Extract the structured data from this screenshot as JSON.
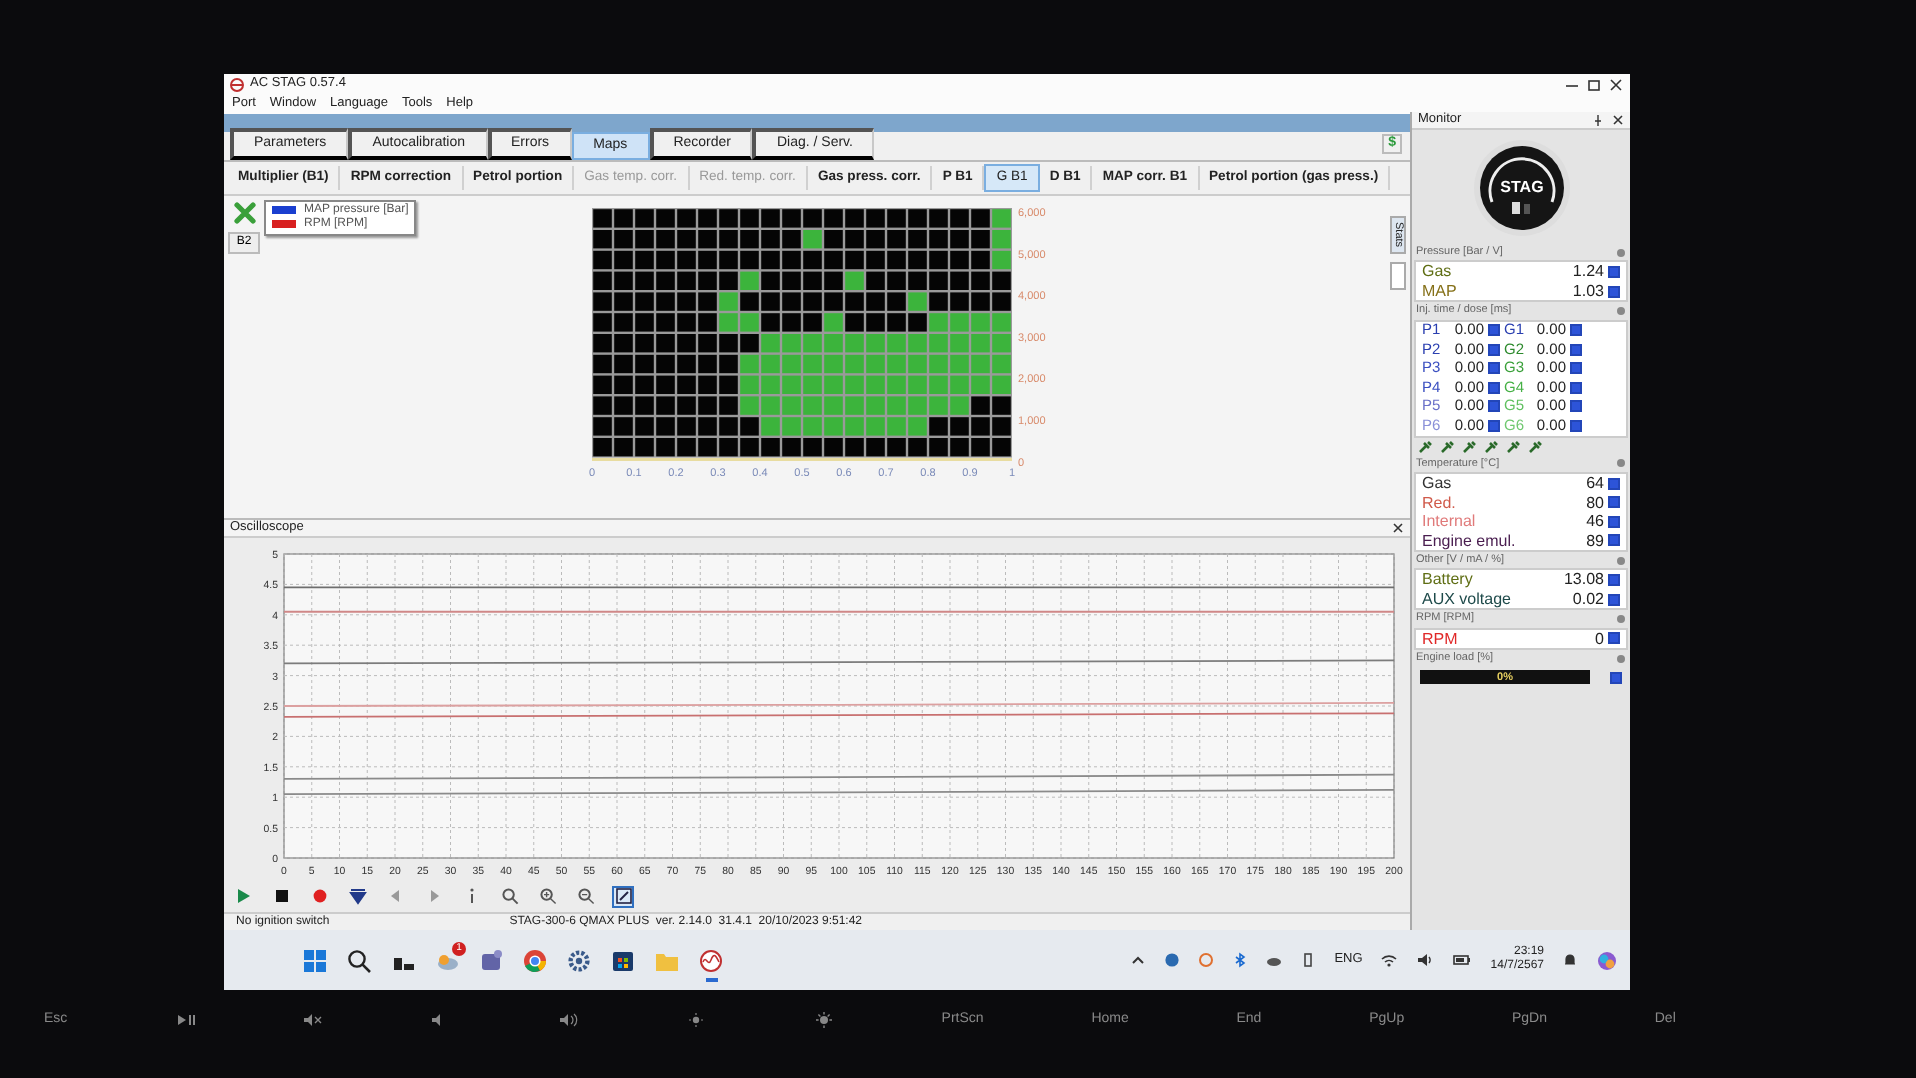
{
  "window": {
    "title": "AC STAG 0.57.4"
  },
  "menu": [
    "Port",
    "Window",
    "Language",
    "Tools",
    "Help"
  ],
  "tabs": [
    {
      "label": "Parameters",
      "selected": false
    },
    {
      "label": "Autocalibration",
      "selected": false
    },
    {
      "label": "Errors",
      "selected": false
    },
    {
      "label": "Maps",
      "selected": true
    },
    {
      "label": "Recorder",
      "selected": false
    },
    {
      "label": "Diag. / Serv.",
      "selected": false
    }
  ],
  "tabs_side_button": "$",
  "subtabs": [
    {
      "label": "Multiplier (B1)",
      "selected": false,
      "disabled": false
    },
    {
      "label": "RPM correction",
      "selected": false,
      "disabled": false
    },
    {
      "label": "Petrol portion",
      "selected": false,
      "disabled": false
    },
    {
      "label": "Gas temp. corr.",
      "selected": false,
      "disabled": true
    },
    {
      "label": "Red. temp. corr.",
      "selected": false,
      "disabled": true
    },
    {
      "label": "Gas press. corr.",
      "selected": false,
      "disabled": false
    },
    {
      "label": "P B1",
      "selected": false,
      "disabled": false
    },
    {
      "label": "G B1",
      "selected": true,
      "disabled": false
    },
    {
      "label": "D B1",
      "selected": false,
      "disabled": false
    },
    {
      "label": "MAP corr. B1",
      "selected": false,
      "disabled": false
    },
    {
      "label": "Petrol portion (gas press.)",
      "selected": false,
      "disabled": false
    }
  ],
  "map": {
    "bank_button": "B2",
    "legend": [
      {
        "label": "MAP pressure [Bar]",
        "color": "#1a3fd0"
      },
      {
        "label": "RPM [RPM]",
        "color": "#d82020"
      }
    ],
    "x_labels": [
      "0",
      "0.1",
      "0.2",
      "0.3",
      "0.4",
      "0.5",
      "0.6",
      "0.7",
      "0.8",
      "0.9",
      "1"
    ],
    "y_labels": [
      "6,000",
      "5,000",
      "4,000",
      "3,000",
      "2,000",
      "1,000",
      "0"
    ],
    "grid": [
      [
        false,
        false,
        false,
        false,
        false,
        false,
        false,
        false,
        false,
        false,
        false,
        false,
        false,
        false,
        false,
        false,
        false,
        false,
        false,
        true
      ],
      [
        false,
        false,
        false,
        false,
        false,
        false,
        false,
        false,
        false,
        false,
        true,
        false,
        false,
        false,
        false,
        false,
        false,
        false,
        false,
        true
      ],
      [
        false,
        false,
        false,
        false,
        false,
        false,
        false,
        false,
        false,
        false,
        false,
        false,
        false,
        false,
        false,
        false,
        false,
        false,
        false,
        true
      ],
      [
        false,
        false,
        false,
        false,
        false,
        false,
        false,
        true,
        false,
        false,
        false,
        false,
        true,
        false,
        false,
        false,
        false,
        false,
        false,
        false
      ],
      [
        false,
        false,
        false,
        false,
        false,
        false,
        true,
        false,
        false,
        false,
        false,
        false,
        false,
        false,
        false,
        true,
        false,
        false,
        false,
        false
      ],
      [
        false,
        false,
        false,
        false,
        false,
        false,
        true,
        true,
        false,
        false,
        false,
        true,
        false,
        false,
        false,
        false,
        true,
        true,
        true,
        true
      ],
      [
        false,
        false,
        false,
        false,
        false,
        false,
        false,
        false,
        true,
        true,
        true,
        true,
        true,
        true,
        true,
        true,
        true,
        true,
        true,
        true
      ],
      [
        false,
        false,
        false,
        false,
        false,
        false,
        false,
        true,
        true,
        true,
        true,
        true,
        true,
        true,
        true,
        true,
        true,
        true,
        true,
        true
      ],
      [
        false,
        false,
        false,
        false,
        false,
        false,
        false,
        true,
        true,
        true,
        true,
        true,
        true,
        true,
        true,
        true,
        true,
        true,
        true,
        true
      ],
      [
        false,
        false,
        false,
        false,
        false,
        false,
        false,
        true,
        true,
        true,
        true,
        true,
        true,
        true,
        true,
        true,
        true,
        true,
        false,
        false
      ],
      [
        false,
        false,
        false,
        false,
        false,
        false,
        false,
        false,
        true,
        true,
        true,
        true,
        true,
        true,
        true,
        true,
        false,
        false,
        false,
        false
      ],
      [
        false,
        false,
        false,
        false,
        false,
        false,
        false,
        false,
        false,
        false,
        false,
        false,
        false,
        false,
        false,
        false,
        false,
        false,
        false,
        false
      ]
    ],
    "side_tabs": [
      {
        "label": "Stats"
      }
    ]
  },
  "oscilloscope": {
    "title": "Oscilloscope",
    "chart_data": {
      "type": "line",
      "grid": true,
      "xlim": [
        0,
        200
      ],
      "ylim": [
        0,
        5
      ],
      "xticks": [
        0,
        5,
        10,
        15,
        20,
        25,
        30,
        35,
        40,
        45,
        50,
        55,
        60,
        65,
        70,
        75,
        80,
        85,
        90,
        95,
        100,
        105,
        110,
        115,
        120,
        125,
        130,
        135,
        140,
        145,
        150,
        155,
        160,
        165,
        170,
        175,
        180,
        185,
        190,
        195,
        200
      ],
      "yticks": [
        0,
        0.5,
        1,
        1.5,
        2,
        2.5,
        3,
        3.5,
        4,
        4.5,
        5
      ],
      "x": [
        0,
        100,
        200
      ],
      "series": [
        {
          "color": "#6e6e6e",
          "values": [
            4.45,
            4.45,
            4.45
          ]
        },
        {
          "color": "#d08888",
          "values": [
            4.05,
            4.05,
            4.05
          ]
        },
        {
          "color": "#7c7c7c",
          "values": [
            3.2,
            3.22,
            3.25
          ]
        },
        {
          "color": "#dca0a0",
          "values": [
            2.5,
            2.52,
            2.55
          ]
        },
        {
          "color": "#c87070",
          "values": [
            2.32,
            2.35,
            2.38
          ]
        },
        {
          "color": "#8a8a8a",
          "values": [
            1.3,
            1.33,
            1.37
          ]
        },
        {
          "color": "#8a8a8a",
          "values": [
            1.05,
            1.08,
            1.12
          ]
        }
      ]
    },
    "toolbar": [
      {
        "kind": "play",
        "selected": false
      },
      {
        "kind": "stop",
        "selected": false
      },
      {
        "kind": "record",
        "selected": false
      },
      {
        "kind": "down",
        "selected": false
      },
      {
        "kind": "prev",
        "selected": false
      },
      {
        "kind": "next",
        "selected": false
      },
      {
        "kind": "info",
        "selected": false
      },
      {
        "kind": "search",
        "selected": false
      },
      {
        "kind": "zoomin",
        "selected": false
      },
      {
        "kind": "zoomout",
        "selected": false
      },
      {
        "kind": "select",
        "selected": true
      }
    ]
  },
  "status_bar": {
    "left": "No ignition switch",
    "right": "STAG-300-6 QMAX PLUS  ver. 2.14.0  31.4.1  20/10/2023 9:51:42"
  },
  "monitor": {
    "title": "Monitor",
    "logo": "STAG",
    "sections": [
      {
        "kind": "values",
        "title": "Pressure [Bar / V]",
        "rows": [
          {
            "label": "Gas",
            "value": "1.24",
            "checked": true,
            "color": "#5f6e14"
          },
          {
            "label": "MAP",
            "value": "1.03",
            "checked": true,
            "color": "#857018"
          }
        ]
      },
      {
        "kind": "injection",
        "title": "Inj. time / dose [ms]",
        "rows": [
          {
            "petrol": {
              "label": "P1",
              "color": "#2a3fb0",
              "value": "0.00",
              "checked": true
            },
            "gas": {
              "label": "G1",
              "color": "#2a3fb0",
              "value": "0.00",
              "checked": true
            }
          },
          {
            "petrol": {
              "label": "P2",
              "color": "#2a3fb0",
              "value": "0.00",
              "checked": true
            },
            "gas": {
              "label": "G2",
              "color": "#2d8a2d",
              "value": "0.00",
              "checked": true
            }
          },
          {
            "petrol": {
              "label": "P3",
              "color": "#3a4fc0",
              "value": "0.00",
              "checked": true
            },
            "gas": {
              "label": "G3",
              "color": "#3aa03a",
              "value": "0.00",
              "checked": true
            }
          },
          {
            "petrol": {
              "label": "P4",
              "color": "#3a4fc0",
              "value": "0.00",
              "checked": true
            },
            "gas": {
              "label": "G4",
              "color": "#45b045",
              "value": "0.00",
              "checked": true
            }
          },
          {
            "petrol": {
              "label": "P5",
              "color": "#6a70c8",
              "value": "0.00",
              "checked": true
            },
            "gas": {
              "label": "G5",
              "color": "#60c060",
              "value": "0.00",
              "checked": true
            }
          },
          {
            "petrol": {
              "label": "P6",
              "color": "#8a90d8",
              "value": "0.00",
              "checked": true
            },
            "gas": {
              "label": "G6",
              "color": "#70c870",
              "value": "0.00",
              "checked": true
            }
          }
        ]
      },
      {
        "kind": "values",
        "title": "Temperature [°C]",
        "rows": [
          {
            "label": "Gas",
            "value": "64",
            "checked": true,
            "color": "#333333"
          },
          {
            "label": "Red.",
            "value": "80",
            "checked": true,
            "color": "#d05a4a"
          },
          {
            "label": "Internal",
            "value": "46",
            "checked": true,
            "color": "#e07a7a"
          },
          {
            "label": "Engine emul.",
            "value": "89",
            "checked": true,
            "color": "#4a1e50"
          }
        ]
      },
      {
        "kind": "values",
        "title": "Other [V / mA / %]",
        "rows": [
          {
            "label": "Battery",
            "value": "13.08",
            "checked": true,
            "color": "#5f6e14"
          },
          {
            "label": "AUX voltage",
            "value": "0.02",
            "checked": true,
            "color": "#1e4a4a"
          }
        ]
      },
      {
        "kind": "values",
        "title": "RPM [RPM]",
        "rows": [
          {
            "label": "RPM",
            "value": "0",
            "checked": true,
            "color": "#e02828"
          }
        ]
      },
      {
        "kind": "load",
        "title": "Engine load [%]",
        "value": "0%",
        "level": 0,
        "checked": true
      }
    ]
  },
  "taskbar": {
    "apps": [
      {
        "kind": "start",
        "running": false
      },
      {
        "kind": "search",
        "running": false
      },
      {
        "kind": "taskview",
        "running": false
      },
      {
        "kind": "weather",
        "running": false,
        "badge": "1"
      },
      {
        "kind": "teams",
        "running": false
      },
      {
        "kind": "chrome",
        "running": false
      },
      {
        "kind": "settings",
        "running": false
      },
      {
        "kind": "store",
        "running": false
      },
      {
        "kind": "folder",
        "running": false
      },
      {
        "kind": "stag",
        "running": true
      }
    ],
    "language": "ENG",
    "time": "23:19",
    "date": "14/7/2567"
  },
  "keyboard": [
    {
      "kind": "text",
      "label": "Esc"
    },
    {
      "kind": "playpause"
    },
    {
      "kind": "mute"
    },
    {
      "kind": "voldown"
    },
    {
      "kind": "volup"
    },
    {
      "kind": "brightdown"
    },
    {
      "kind": "brightup"
    },
    {
      "kind": "text",
      "label": "PrtScn"
    },
    {
      "kind": "text",
      "label": "Home"
    },
    {
      "kind": "text",
      "label": "End"
    },
    {
      "kind": "text",
      "label": "PgUp"
    },
    {
      "kind": "text",
      "label": "PgDn"
    },
    {
      "kind": "text",
      "label": "Del"
    }
  ]
}
